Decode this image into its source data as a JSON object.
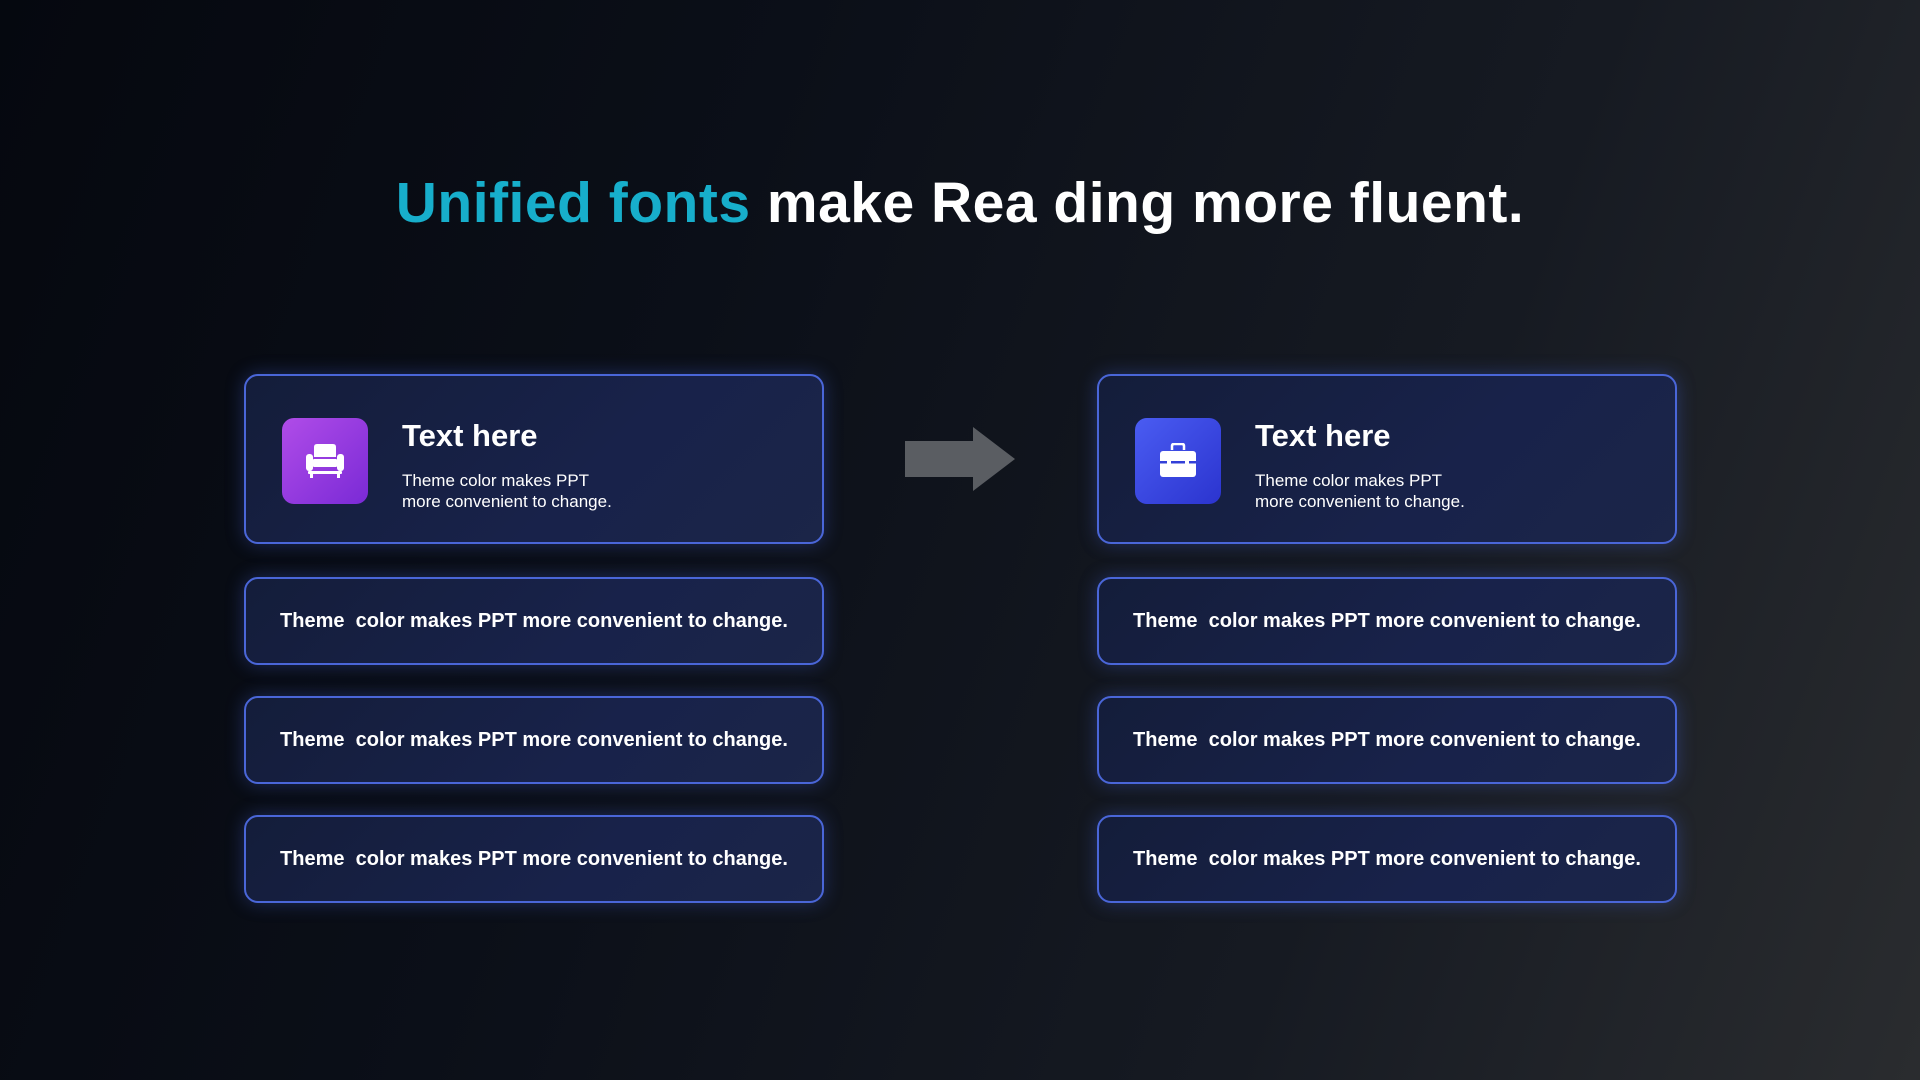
{
  "title": {
    "accent": "Unified fonts",
    "rest": " make Rea ding more fluent."
  },
  "colors": {
    "accent": "#17aecb",
    "card_border": "#4a66d8",
    "icon_left": "#9b3de2",
    "icon_right": "#3b47e6",
    "arrow": "#5a5d62"
  },
  "left": {
    "icon": "armchair-icon",
    "heading": "Text here",
    "description": "Theme  color makes PPT\nmore convenient to change.",
    "items": [
      "Theme  color makes PPT more convenient to change.",
      "Theme  color makes PPT more convenient to change.",
      "Theme  color makes PPT more convenient to change."
    ]
  },
  "right": {
    "icon": "toolbox-icon",
    "heading": "Text here",
    "description": "Theme  color makes PPT\nmore convenient to change.",
    "items": [
      "Theme  color makes PPT more convenient to change.",
      "Theme  color makes PPT more convenient to change.",
      "Theme  color makes PPT more convenient to change."
    ]
  },
  "connector_icon": "arrow-right-icon"
}
